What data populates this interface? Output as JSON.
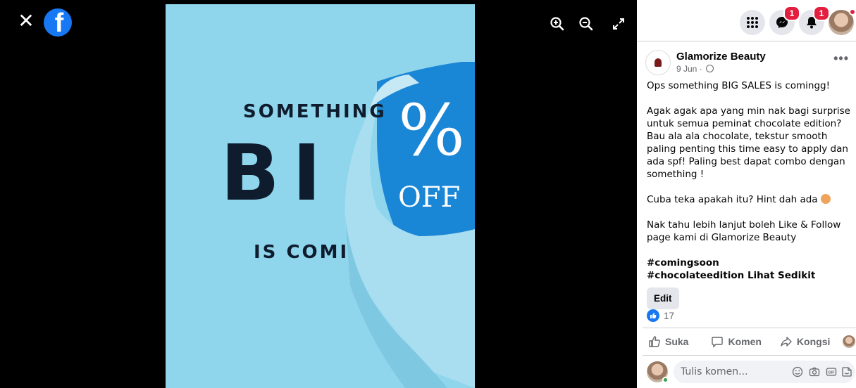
{
  "viewer": {
    "close_icon": "close-icon",
    "logo_icon": "facebook-logo",
    "logo_letter": "f",
    "tools": [
      "zoom-in-icon",
      "zoom-out-icon",
      "fullscreen-icon"
    ],
    "photo": {
      "line1": "SOMETHING",
      "line2": "BI",
      "line3": "IS COMI",
      "percent": "%",
      "off": "OFF"
    }
  },
  "topbar": {
    "messenger_badge": "1",
    "notifications_badge": "1"
  },
  "post": {
    "page_name": "Glamorize Beauty",
    "date": "9 Jun ·",
    "paragraphs": [
      "Ops something BIG SALES is comingg!",
      "Agak agak apa yang min nak bagi surprise untuk semua peminat chocolate edition? Bau ala ala chocolate, tekstur smooth paling penting this time easy to apply dan ada spf! Paling best dapat combo dengan something !",
      "Cuba teka apakah itu? Hint dah ada",
      "Nak tahu lebih lanjut boleh Like & Follow page kami di Glamorize Beauty"
    ],
    "hashtag1": "#comingsoon",
    "hashtag2": "#chocolateedition",
    "see_more": "Lihat Sedikit",
    "edit_label": "Edit",
    "like_count": "17",
    "actions": {
      "like": "Suka",
      "comment": "Komen",
      "share": "Kongsi"
    },
    "comment_placeholder": "Tulis komen..."
  },
  "colors": {
    "brand": "#1877f2",
    "badge": "#e41e3f",
    "photo_bg": "#8fd5ec",
    "photo_dark_blue": "#1a86d6"
  }
}
